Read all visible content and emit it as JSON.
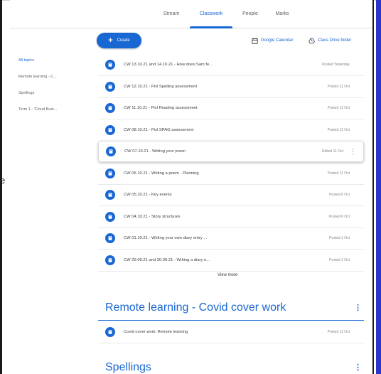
{
  "tabs": [
    {
      "label": "Stream",
      "active": false
    },
    {
      "label": "Classwork",
      "active": true
    },
    {
      "label": "People",
      "active": false
    },
    {
      "label": "Marks",
      "active": false
    }
  ],
  "sidebar": {
    "items": [
      {
        "label": "All topics",
        "active": true
      },
      {
        "label": "Remote learning - C...",
        "active": false
      },
      {
        "label": "Spellings",
        "active": false
      },
      {
        "label": "Term 1 - 'Cloud Bust...",
        "active": false
      }
    ]
  },
  "actions": {
    "create_label": "Create",
    "calendar_label": "Google Calendar",
    "drive_label": "Class Drive folder"
  },
  "assignments": [
    {
      "title": "CW 13.10.21 and 14.10.21 - How does Sam fe...",
      "status": "Posted Yesterday"
    },
    {
      "title": "CW 12.10.21 - Pixl Spelling assessment",
      "status": "Posted 11 Oct"
    },
    {
      "title": "CW 11.10.21 - Pixl Reading assessment",
      "status": "Posted 11 Oct"
    },
    {
      "title": "CW 08.10.21 - Pixl SPAG assessment",
      "status": "Posted 11 Oct"
    },
    {
      "title": "CW 07.10.21 - Writing your poem",
      "status": "Edited 11 Oct"
    },
    {
      "title": "CW 06.10.21 - Writing a poem - Planning",
      "status": "Posted 11 Oct"
    },
    {
      "title": "CW 05.10.21 - Key events",
      "status": "Posted 6 Oct"
    },
    {
      "title": "CW 04.10.21 - Story structures",
      "status": "Posted 6 Oct"
    },
    {
      "title": "CW 01.10.21 - Writing your own diary entry ...",
      "status": "Posted 1 Oct"
    },
    {
      "title": "CW 29.09.21 and 30.09.21 - Writing a diary e...",
      "status": "Posted 1 Oct"
    }
  ],
  "view_more_label": "View more",
  "topics": [
    {
      "title": "Remote learning - Covid cover work",
      "items": [
        {
          "title": "Covid cover work: Remote learning",
          "status": "Posted 11 Oct"
        }
      ]
    },
    {
      "title": "Spellings",
      "items": []
    }
  ],
  "cutoff_text": "e",
  "colors": {
    "accent": "#1967d2",
    "frame_right": "#2b35c9"
  }
}
